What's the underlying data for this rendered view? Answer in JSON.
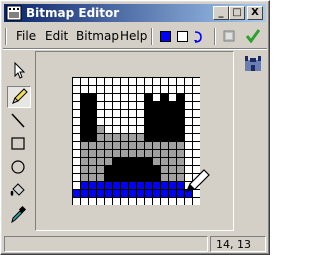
{
  "window": {
    "title": "Bitmap Editor"
  },
  "title_buttons": {
    "minimize": "_",
    "maximize": "□",
    "close": "X"
  },
  "menu": [
    "File",
    "Edit",
    "Bitmap",
    "Help"
  ],
  "colors": {
    "primary": "#0000ff",
    "secondary": "#ffffff",
    "accent_check": "#2da12d"
  },
  "tools": [
    {
      "name": "select-arrow-icon"
    },
    {
      "name": "pencil-icon",
      "selected": true
    },
    {
      "name": "line-icon"
    },
    {
      "name": "rectangle-icon"
    },
    {
      "name": "ellipse-icon"
    },
    {
      "name": "fill-bucket-icon"
    },
    {
      "name": "color-picker-icon"
    }
  ],
  "bitmap": {
    "size": 16,
    "palette": {
      "W": "#ffffff",
      "K": "#000000",
      "G": "#a0a0a0",
      "B": "#0000ff"
    },
    "rows": [
      "WWWWWWWWWWWWWWWW",
      "WWWWWWWWWWWWWWWW",
      "WKKWWWWWWKWKWKWW",
      "WKKWWWWWWKKKKKWW",
      "WKKWWWWWWKKKKKWW",
      "WKKWWWWWWKKKKKWW",
      "WKKGWWWWWKKKKKWW",
      "WKKGGGGGGKKKKKWW",
      "WGGGGGGGGGGGGGWW",
      "WGGGGGGGGGGGGGWW",
      "WGGGGKKKKKGGGGWW",
      "WGGGKKKKKKKGGGWW",
      "WGGGKKKKKKKGGGWW",
      "WBBBBBBBBBBBBBWW",
      "BBBBBBBBBBBBBBBW",
      "WWWWWWWWWWWWWWWW"
    ]
  },
  "status": {
    "message": "",
    "coords": "14, 13"
  }
}
